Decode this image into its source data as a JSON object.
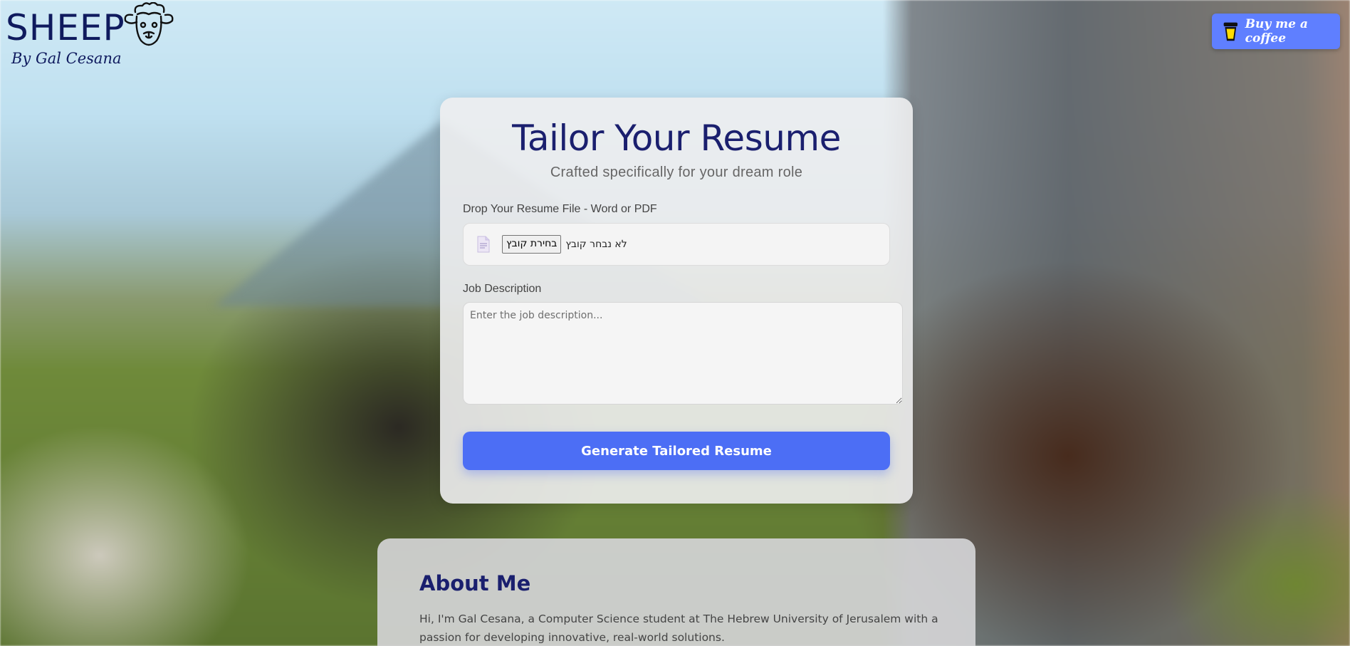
{
  "logo": {
    "title": "SHEEP",
    "subtitle": "By Gal Cesana",
    "icon": "sheep-head-icon"
  },
  "coffee": {
    "label": "Buy me a coffee",
    "icon": "coffee-cup-icon",
    "color": "#5f7fff"
  },
  "form": {
    "title": "Tailor Your Resume",
    "subtitle": "Crafted specifically for your dream role",
    "resume_label": "Drop Your Resume File - Word or PDF",
    "file_icon": "document-icon",
    "choose_file_label": "בחירת קובץ",
    "file_status": "לא נבחר קובץ",
    "job_label": "Job Description",
    "job_placeholder": "Enter the job description...",
    "submit_label": "Generate Tailored Resume",
    "accent": "#4c6ef5",
    "title_color": "#1a1f6e"
  },
  "about": {
    "title": "About Me",
    "text": "Hi, I'm Gal Cesana, a Computer Science student at The Hebrew University of Jerusalem with a passion for developing innovative, real-world solutions."
  }
}
